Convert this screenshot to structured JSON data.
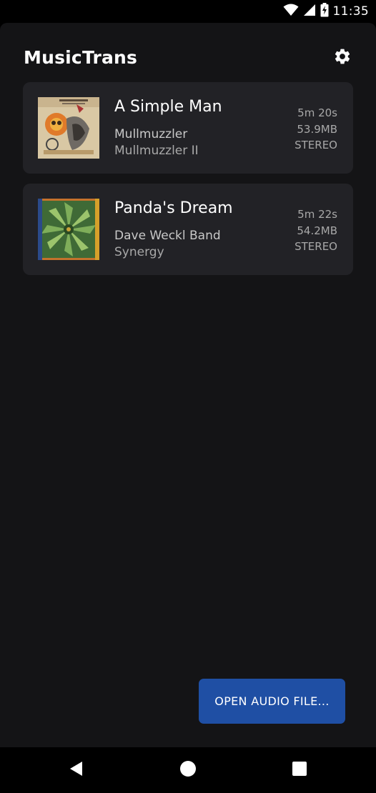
{
  "status_bar": {
    "time": "11:35",
    "icons": [
      "wifi-icon",
      "signal-icon",
      "battery-charging-icon"
    ]
  },
  "app": {
    "title": "MusicTrans",
    "settings_icon": "gear-icon"
  },
  "tracks": [
    {
      "title": "A Simple Man",
      "artist": "Mullmuzzler",
      "album": "Mullmuzzler II",
      "duration": "5m 20s",
      "size": "53.9MB",
      "channels": "STEREO"
    },
    {
      "title": "Panda's Dream",
      "artist": "Dave Weckl Band",
      "album": "Synergy",
      "duration": "5m 22s",
      "size": "54.2MB",
      "channels": "STEREO"
    }
  ],
  "actions": {
    "open_audio_file_label": "OPEN AUDIO FILE..."
  },
  "nav_bar": {
    "icons": [
      "back-icon",
      "home-icon",
      "recents-icon"
    ]
  },
  "colors": {
    "background": "#141416",
    "card": "#222226",
    "accent": "#1f4fa4",
    "text_primary": "#ffffff",
    "text_secondary": "#a8a8a8"
  }
}
